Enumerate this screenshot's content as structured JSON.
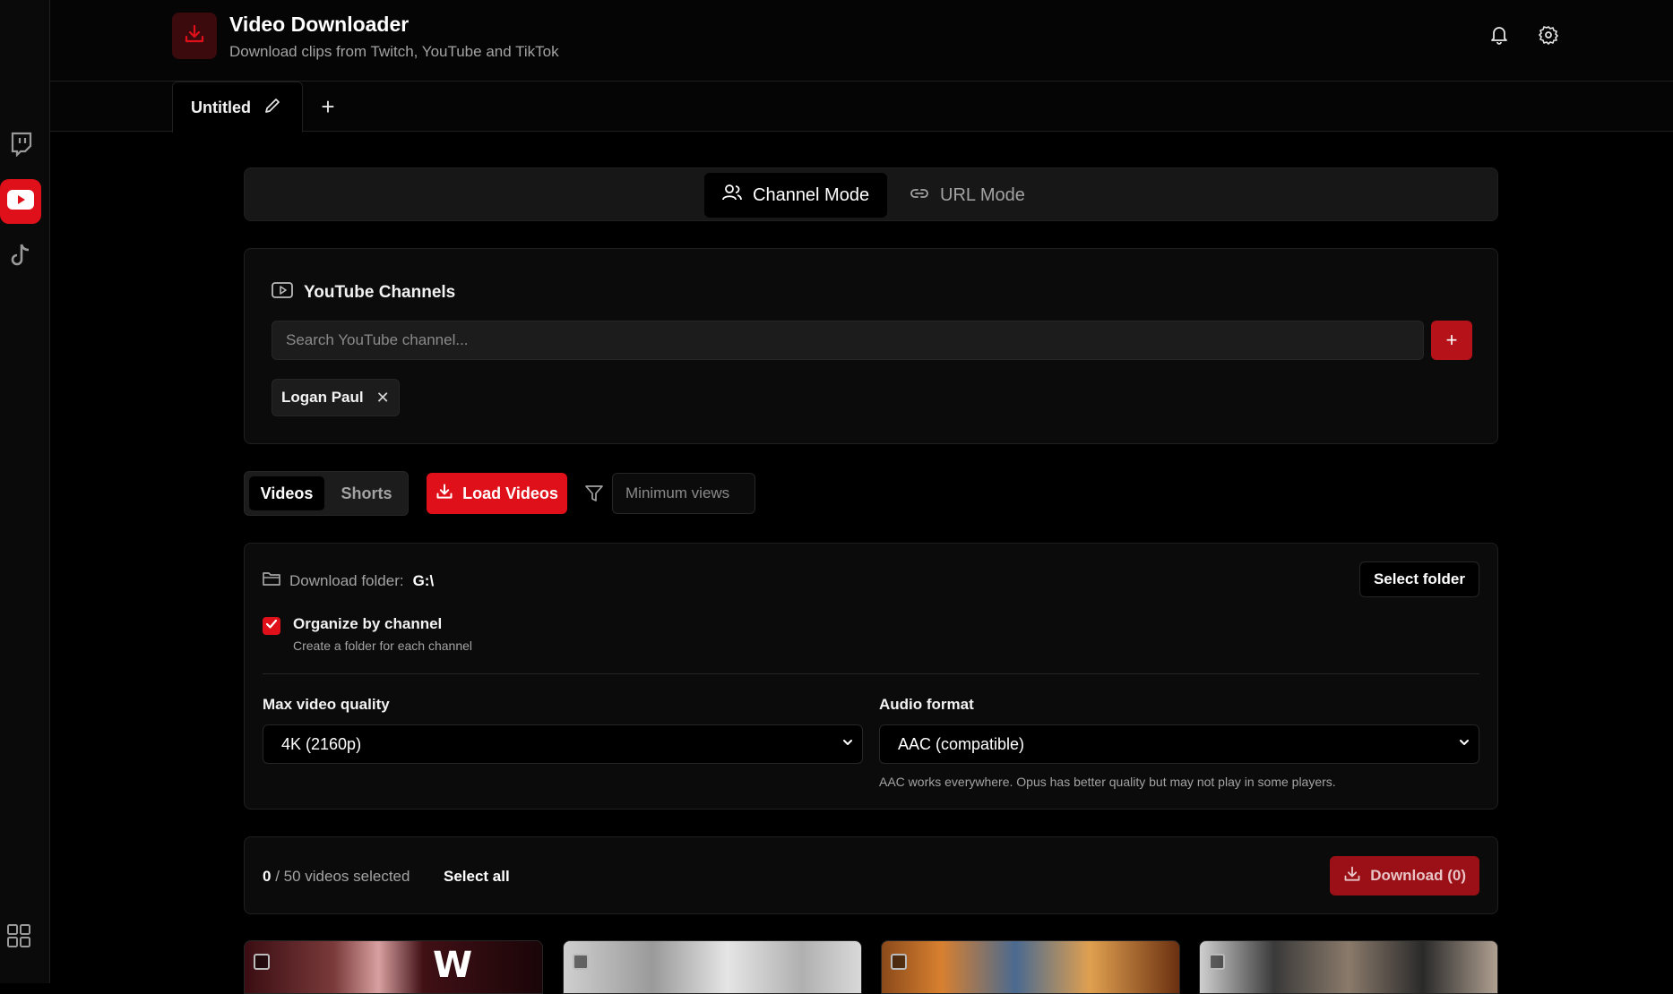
{
  "app": {
    "title": "Video Downloader",
    "subtitle": "Download clips from Twitch, YouTube and TikTok",
    "accent": "#e0101a"
  },
  "sidebar": {
    "items": [
      {
        "name": "twitch",
        "icon": "twitch-icon",
        "active": false
      },
      {
        "name": "youtube",
        "icon": "youtube-icon",
        "active": true
      },
      {
        "name": "tiktok",
        "icon": "tiktok-icon",
        "active": false
      }
    ],
    "bottom_icon": "apps-grid-icon"
  },
  "header_icons": [
    "bell-icon",
    "gear-icon"
  ],
  "tabs": [
    {
      "label": "Untitled",
      "active": true
    }
  ],
  "modes": [
    {
      "label": "Channel Mode",
      "active": true,
      "icon": "users-icon"
    },
    {
      "label": "URL Mode",
      "active": false,
      "icon": "link-icon"
    }
  ],
  "channels": {
    "title": "YouTube Channels",
    "search_placeholder": "Search YouTube channel...",
    "chips": [
      "Logan Paul"
    ]
  },
  "content_type": {
    "options": [
      "Videos",
      "Shorts"
    ],
    "selected": "Videos"
  },
  "load_button": "Load Videos",
  "min_views_placeholder": "Minimum views",
  "settings": {
    "folder_label": "Download folder:",
    "folder_value": "G:\\",
    "select_folder": "Select folder",
    "organize_title": "Organize by channel",
    "organize_sub": "Create a folder for each channel",
    "organize_checked": true,
    "quality_label": "Max video quality",
    "quality_value": "4K (2160p)",
    "audio_label": "Audio format",
    "audio_value": "AAC (compatible)",
    "audio_hint": "AAC works everywhere. Opus has better quality but may not play in some players."
  },
  "selection": {
    "selected": "0",
    "total_text": "/ 50 videos selected",
    "select_all": "Select all",
    "download_label": "Download (0)"
  },
  "video_cards_visible": 4
}
